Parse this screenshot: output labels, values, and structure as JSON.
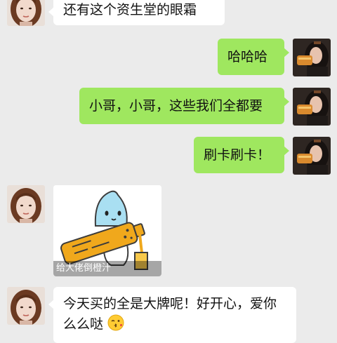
{
  "messages": [
    {
      "side": "in",
      "text": "还有这个资生堂的眼霜"
    },
    {
      "side": "out",
      "text": "哈哈哈"
    },
    {
      "side": "out",
      "text": "小哥，小哥，这些我们全都要"
    },
    {
      "side": "out",
      "text": "刷卡刷卡！"
    },
    {
      "side": "in",
      "type": "sticker",
      "caption": "给大佬倒橙汁"
    },
    {
      "side": "in",
      "line1": "今天买的全是大牌呢！好开心，爱你",
      "line2": "么么哒"
    }
  ],
  "icons": {
    "incoming_avatar": "girl-avatar-icon",
    "outgoing_avatar": "drinking-girl-avatar-icon",
    "emoji": "kissing-face-icon",
    "sticker": "cartoon-pouring-juice-sticker"
  },
  "colors": {
    "background": "#ebebeb",
    "incoming_bubble": "#ffffff",
    "outgoing_bubble": "#9fe75f"
  }
}
